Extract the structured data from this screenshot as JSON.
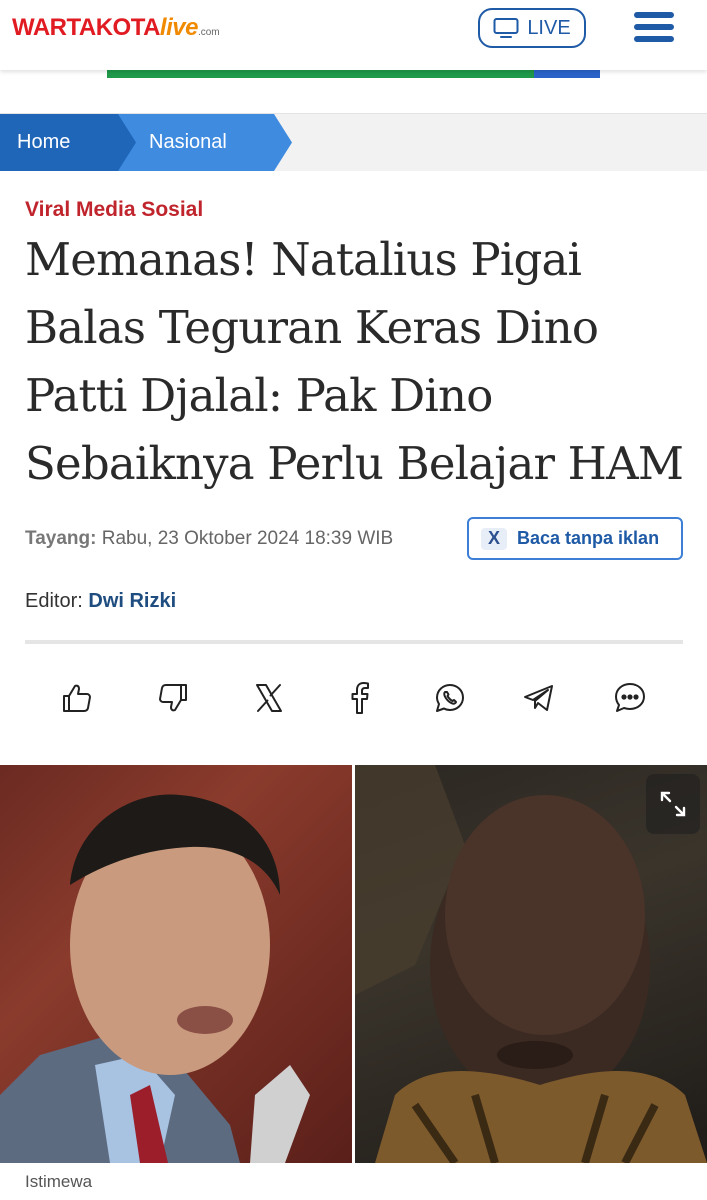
{
  "header": {
    "logo": {
      "brand": "WARTAKOTA",
      "live": "live",
      "domain": ".com"
    },
    "live_button": "LIVE",
    "colors": {
      "brand_red": "#e11b22",
      "brand_blue": "#1f5aa6"
    }
  },
  "breadcrumb": [
    {
      "label": "Home"
    },
    {
      "label": "Nasional"
    }
  ],
  "article": {
    "category": "Viral Media Sosial",
    "title": "Memanas! Natalius Pigai Balas Teguran Keras Dino Patti Djalal: Pak Dino Sebaiknya Perlu Belajar HAM",
    "published_label": "Tayang:",
    "published_value": "Rabu, 23 Oktober 2024 18:39 WIB",
    "no_ads_button": "Baca tanpa iklan",
    "editor_label": "Editor:",
    "editor_name": "Dwi Rizki",
    "image_caption": "Istimewa"
  },
  "share_icons": [
    "thumbs-up-icon",
    "thumbs-down-icon",
    "x-icon",
    "facebook-icon",
    "whatsapp-icon",
    "telegram-icon",
    "comment-icon"
  ]
}
